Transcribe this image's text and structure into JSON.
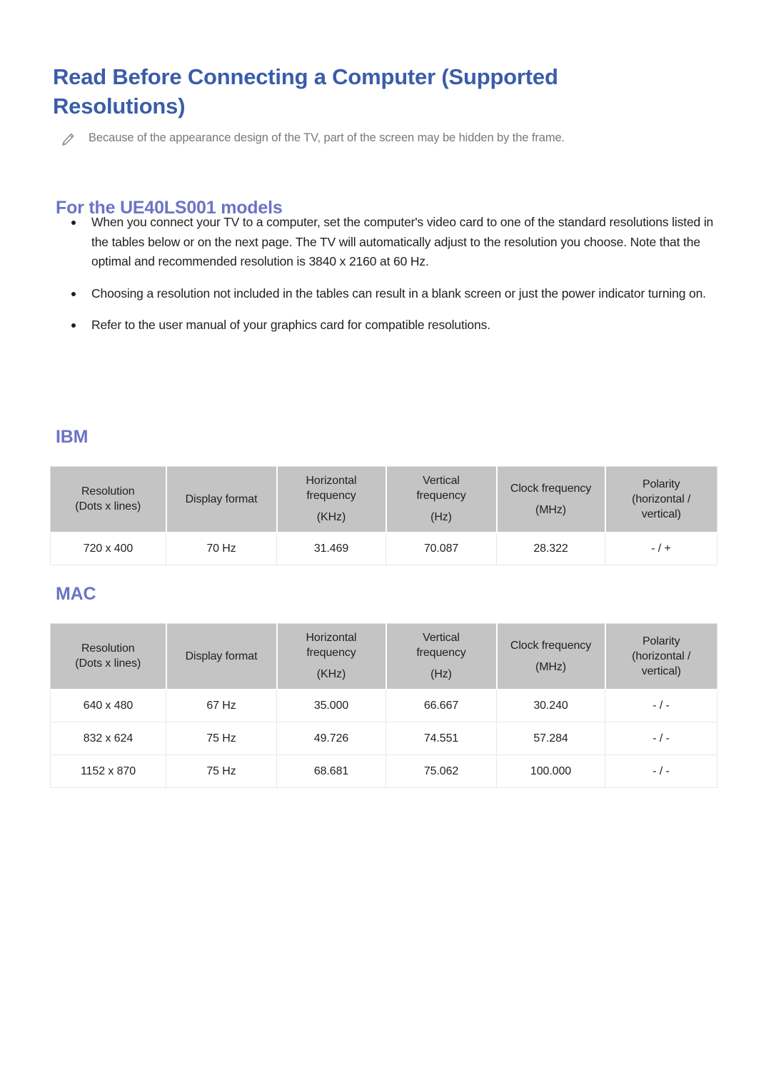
{
  "document": {
    "title": "Read Before Connecting a Computer (Supported Resolutions)",
    "note": {
      "icon": "pencil-icon",
      "text": "Because of the appearance design of the TV, part of the screen may be hidden by the frame."
    },
    "section": {
      "heading": "For the UE40LS001 models",
      "bullets": [
        "When you connect your TV to a computer, set the computer's video card to one of the standard resolutions listed in the tables below or on the next page. The TV will automatically adjust to the resolution you choose. Note that the optimal and recommended resolution is 3840 x 2160 at 60 Hz.",
        "Choosing a resolution not included in the tables can result in a blank screen or just the power indicator turning on.",
        "Refer to the user manual of your graphics card for compatible resolutions."
      ]
    }
  },
  "colors": {
    "title_blue": "#3a5da9",
    "heading_periwinkle": "#6b74c4",
    "table_header_gray": "#c4c4c4",
    "note_gray": "#777777",
    "body_text": "#1f1f1f"
  },
  "tables": [
    {
      "id": "ibm",
      "heading": "IBM",
      "columns": [
        {
          "line1": "Resolution",
          "line2": "(Dots x lines)",
          "unit": ""
        },
        {
          "line1": "Display format",
          "line2": "",
          "unit": ""
        },
        {
          "line1": "Horizontal",
          "line2": "frequency",
          "unit": "(KHz)"
        },
        {
          "line1": "Vertical",
          "line2": "frequency",
          "unit": "(Hz)"
        },
        {
          "line1": "Clock frequency",
          "line2": "",
          "unit": "(MHz)"
        },
        {
          "line1": "Polarity",
          "line2": "(horizontal /",
          "unit": "",
          "line3": "vertical)"
        }
      ],
      "rows": [
        [
          "720 x 400",
          "70 Hz",
          "31.469",
          "70.087",
          "28.322",
          "- / +"
        ]
      ]
    },
    {
      "id": "mac",
      "heading": "MAC",
      "columns": [
        {
          "line1": "Resolution",
          "line2": "(Dots x lines)",
          "unit": ""
        },
        {
          "line1": "Display format",
          "line2": "",
          "unit": ""
        },
        {
          "line1": "Horizontal",
          "line2": "frequency",
          "unit": "(KHz)"
        },
        {
          "line1": "Vertical",
          "line2": "frequency",
          "unit": "(Hz)"
        },
        {
          "line1": "Clock frequency",
          "line2": "",
          "unit": "(MHz)"
        },
        {
          "line1": "Polarity",
          "line2": "(horizontal /",
          "unit": "",
          "line3": "vertical)"
        }
      ],
      "rows": [
        [
          "640 x 480",
          "67 Hz",
          "35.000",
          "66.667",
          "30.240",
          "- / -"
        ],
        [
          "832 x 624",
          "75 Hz",
          "49.726",
          "74.551",
          "57.284",
          "- / -"
        ],
        [
          "1152 x 870",
          "75 Hz",
          "68.681",
          "75.062",
          "100.000",
          "- / -"
        ]
      ]
    }
  ]
}
